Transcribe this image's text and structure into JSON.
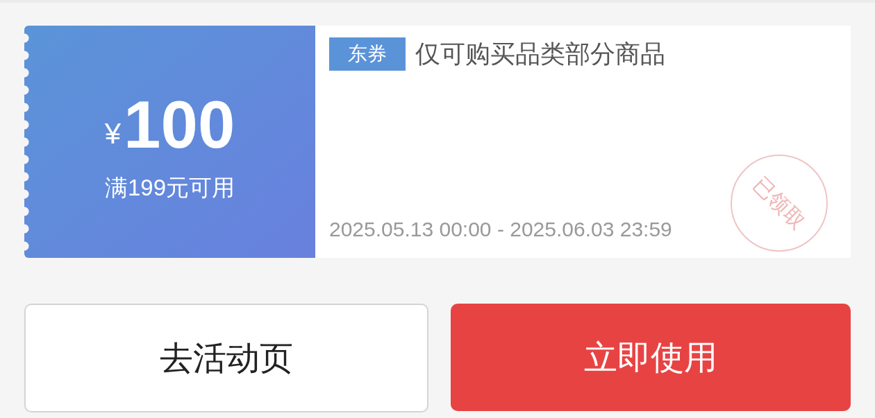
{
  "coupon": {
    "currency": "¥",
    "amount": "100",
    "condition": "满199元可用",
    "tag": "东券",
    "title": "仅可购买品类部分商品",
    "validity": "2025.05.13 00:00 - 2025.06.03 23:59",
    "stamp": "已领取"
  },
  "buttons": [
    {
      "label": "去活动页",
      "kind": "secondary"
    },
    {
      "label": "立即使用",
      "kind": "primary"
    }
  ]
}
